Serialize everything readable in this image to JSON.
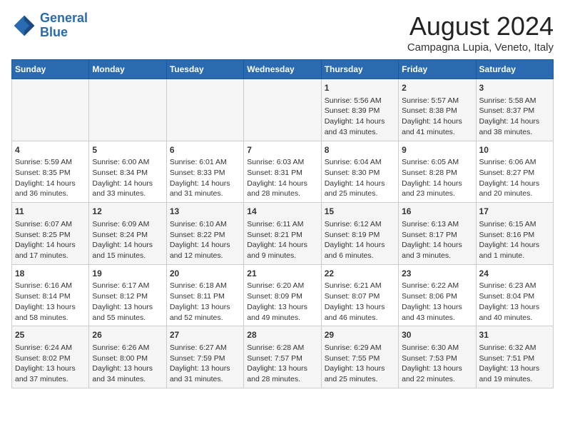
{
  "header": {
    "logo_line1": "General",
    "logo_line2": "Blue",
    "title": "August 2024",
    "subtitle": "Campagna Lupia, Veneto, Italy"
  },
  "days_of_week": [
    "Sunday",
    "Monday",
    "Tuesday",
    "Wednesday",
    "Thursday",
    "Friday",
    "Saturday"
  ],
  "weeks": [
    [
      {
        "day": "",
        "info": ""
      },
      {
        "day": "",
        "info": ""
      },
      {
        "day": "",
        "info": ""
      },
      {
        "day": "",
        "info": ""
      },
      {
        "day": "1",
        "info": "Sunrise: 5:56 AM\nSunset: 8:39 PM\nDaylight: 14 hours\nand 43 minutes."
      },
      {
        "day": "2",
        "info": "Sunrise: 5:57 AM\nSunset: 8:38 PM\nDaylight: 14 hours\nand 41 minutes."
      },
      {
        "day": "3",
        "info": "Sunrise: 5:58 AM\nSunset: 8:37 PM\nDaylight: 14 hours\nand 38 minutes."
      }
    ],
    [
      {
        "day": "4",
        "info": "Sunrise: 5:59 AM\nSunset: 8:35 PM\nDaylight: 14 hours\nand 36 minutes."
      },
      {
        "day": "5",
        "info": "Sunrise: 6:00 AM\nSunset: 8:34 PM\nDaylight: 14 hours\nand 33 minutes."
      },
      {
        "day": "6",
        "info": "Sunrise: 6:01 AM\nSunset: 8:33 PM\nDaylight: 14 hours\nand 31 minutes."
      },
      {
        "day": "7",
        "info": "Sunrise: 6:03 AM\nSunset: 8:31 PM\nDaylight: 14 hours\nand 28 minutes."
      },
      {
        "day": "8",
        "info": "Sunrise: 6:04 AM\nSunset: 8:30 PM\nDaylight: 14 hours\nand 25 minutes."
      },
      {
        "day": "9",
        "info": "Sunrise: 6:05 AM\nSunset: 8:28 PM\nDaylight: 14 hours\nand 23 minutes."
      },
      {
        "day": "10",
        "info": "Sunrise: 6:06 AM\nSunset: 8:27 PM\nDaylight: 14 hours\nand 20 minutes."
      }
    ],
    [
      {
        "day": "11",
        "info": "Sunrise: 6:07 AM\nSunset: 8:25 PM\nDaylight: 14 hours\nand 17 minutes."
      },
      {
        "day": "12",
        "info": "Sunrise: 6:09 AM\nSunset: 8:24 PM\nDaylight: 14 hours\nand 15 minutes."
      },
      {
        "day": "13",
        "info": "Sunrise: 6:10 AM\nSunset: 8:22 PM\nDaylight: 14 hours\nand 12 minutes."
      },
      {
        "day": "14",
        "info": "Sunrise: 6:11 AM\nSunset: 8:21 PM\nDaylight: 14 hours\nand 9 minutes."
      },
      {
        "day": "15",
        "info": "Sunrise: 6:12 AM\nSunset: 8:19 PM\nDaylight: 14 hours\nand 6 minutes."
      },
      {
        "day": "16",
        "info": "Sunrise: 6:13 AM\nSunset: 8:17 PM\nDaylight: 14 hours\nand 3 minutes."
      },
      {
        "day": "17",
        "info": "Sunrise: 6:15 AM\nSunset: 8:16 PM\nDaylight: 14 hours\nand 1 minute."
      }
    ],
    [
      {
        "day": "18",
        "info": "Sunrise: 6:16 AM\nSunset: 8:14 PM\nDaylight: 13 hours\nand 58 minutes."
      },
      {
        "day": "19",
        "info": "Sunrise: 6:17 AM\nSunset: 8:12 PM\nDaylight: 13 hours\nand 55 minutes."
      },
      {
        "day": "20",
        "info": "Sunrise: 6:18 AM\nSunset: 8:11 PM\nDaylight: 13 hours\nand 52 minutes."
      },
      {
        "day": "21",
        "info": "Sunrise: 6:20 AM\nSunset: 8:09 PM\nDaylight: 13 hours\nand 49 minutes."
      },
      {
        "day": "22",
        "info": "Sunrise: 6:21 AM\nSunset: 8:07 PM\nDaylight: 13 hours\nand 46 minutes."
      },
      {
        "day": "23",
        "info": "Sunrise: 6:22 AM\nSunset: 8:06 PM\nDaylight: 13 hours\nand 43 minutes."
      },
      {
        "day": "24",
        "info": "Sunrise: 6:23 AM\nSunset: 8:04 PM\nDaylight: 13 hours\nand 40 minutes."
      }
    ],
    [
      {
        "day": "25",
        "info": "Sunrise: 6:24 AM\nSunset: 8:02 PM\nDaylight: 13 hours\nand 37 minutes."
      },
      {
        "day": "26",
        "info": "Sunrise: 6:26 AM\nSunset: 8:00 PM\nDaylight: 13 hours\nand 34 minutes."
      },
      {
        "day": "27",
        "info": "Sunrise: 6:27 AM\nSunset: 7:59 PM\nDaylight: 13 hours\nand 31 minutes."
      },
      {
        "day": "28",
        "info": "Sunrise: 6:28 AM\nSunset: 7:57 PM\nDaylight: 13 hours\nand 28 minutes."
      },
      {
        "day": "29",
        "info": "Sunrise: 6:29 AM\nSunset: 7:55 PM\nDaylight: 13 hours\nand 25 minutes."
      },
      {
        "day": "30",
        "info": "Sunrise: 6:30 AM\nSunset: 7:53 PM\nDaylight: 13 hours\nand 22 minutes."
      },
      {
        "day": "31",
        "info": "Sunrise: 6:32 AM\nSunset: 7:51 PM\nDaylight: 13 hours\nand 19 minutes."
      }
    ]
  ]
}
